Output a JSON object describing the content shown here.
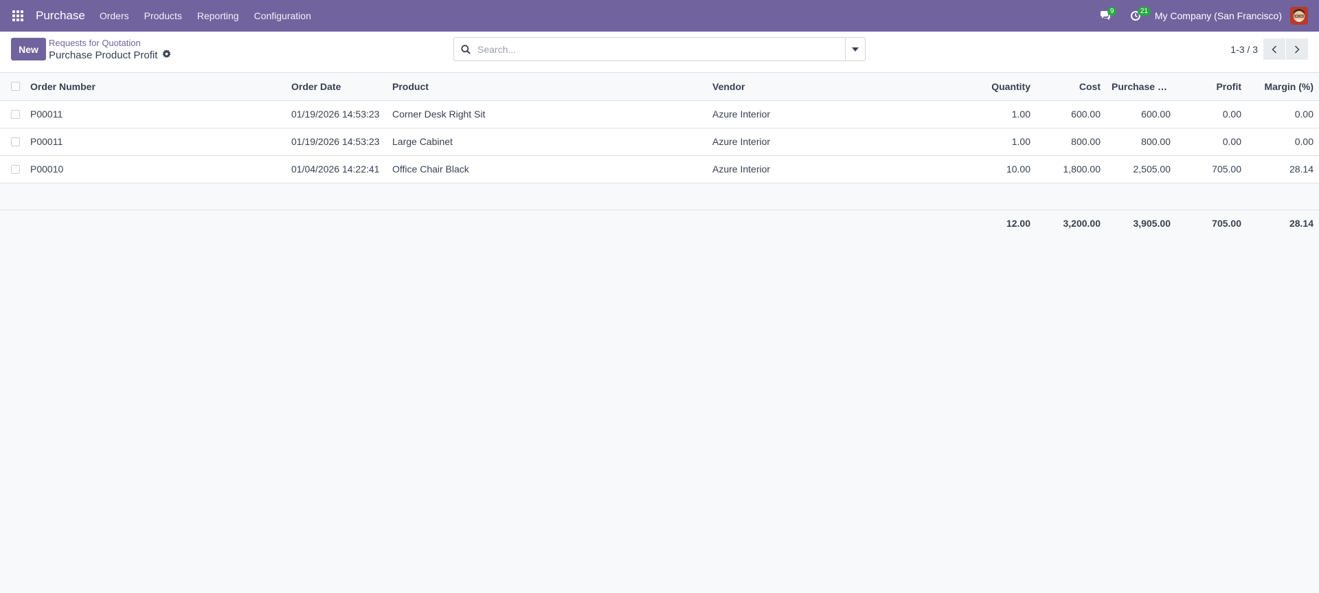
{
  "navbar": {
    "app_name": "Purchase",
    "menu": [
      "Orders",
      "Products",
      "Reporting",
      "Configuration"
    ],
    "messages_count": "9",
    "activities_count": "21",
    "company": "My Company (San Francisco)"
  },
  "control": {
    "new_label": "New",
    "breadcrumb_parent": "Requests for Quotation",
    "breadcrumb_current": "Purchase Product Profit",
    "search_placeholder": "Search...",
    "pager_value": "1-3 / 3"
  },
  "table": {
    "columns": [
      "Order Number",
      "Order Date",
      "Product",
      "Vendor",
      "Quantity",
      "Cost",
      "Purchase Pr…",
      "Profit",
      "Margin (%)"
    ],
    "rows": [
      [
        "P00011",
        "01/19/2026 14:53:23",
        "Corner Desk Right Sit",
        "Azure Interior",
        "1.00",
        "600.00",
        "600.00",
        "0.00",
        "0.00"
      ],
      [
        "P00011",
        "01/19/2026 14:53:23",
        "Large Cabinet",
        "Azure Interior",
        "1.00",
        "800.00",
        "800.00",
        "0.00",
        "0.00"
      ],
      [
        "P00010",
        "01/04/2026 14:22:41",
        "Office Chair Black",
        "Azure Interior",
        "10.00",
        "1,800.00",
        "2,505.00",
        "705.00",
        "28.14"
      ]
    ],
    "totals": {
      "quantity": "12.00",
      "cost": "3,200.00",
      "purchase_price": "3,905.00",
      "profit": "705.00",
      "margin": "28.14"
    }
  },
  "colors": {
    "brand": "#71639e",
    "badge": "#28a745"
  }
}
